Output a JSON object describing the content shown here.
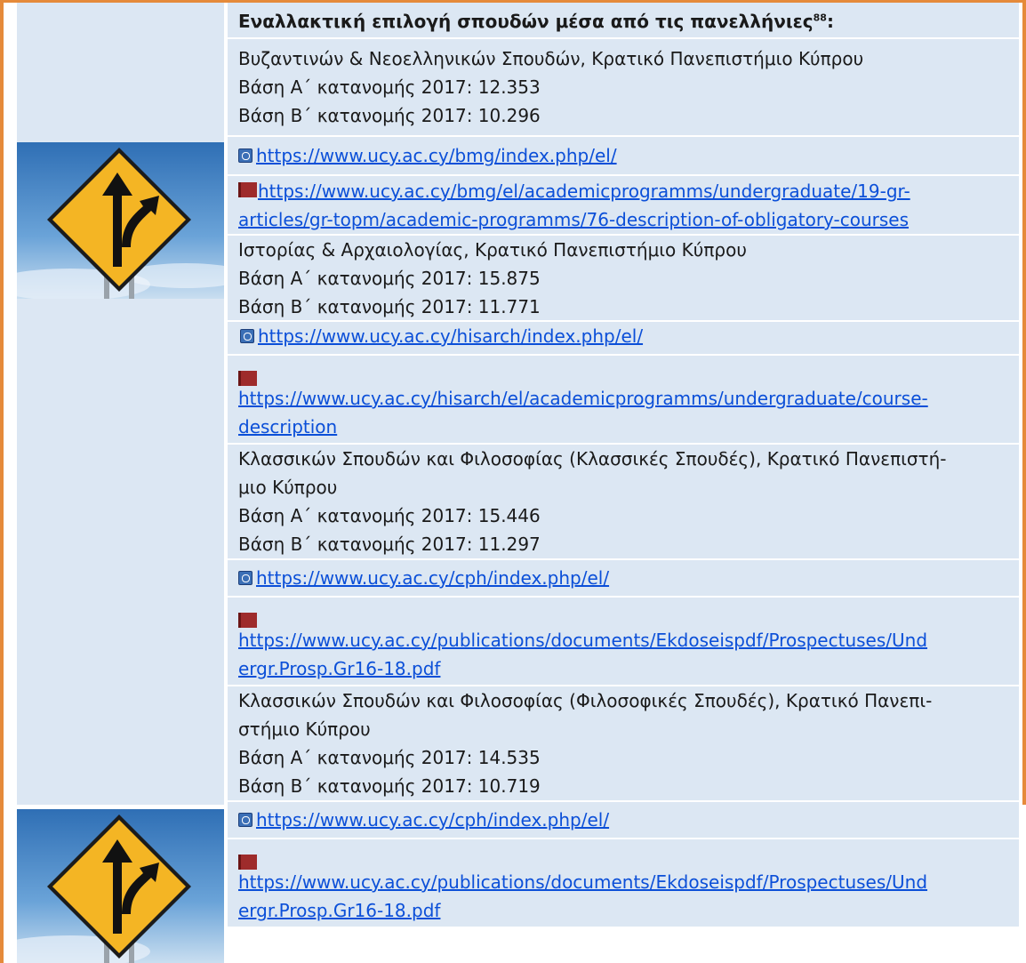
{
  "header": {
    "title": "Εναλλακτική επιλογή σπουδών μέσα από τις πανελλήνιες",
    "footnote": "88",
    "suffix": ":"
  },
  "programs": [
    {
      "name": "Βυζαντινών & Νεοελληνικών Σπουδών, Κρατικό Πανεπιστήμιο Κύπρου",
      "base_a": "Βάση Α΄ κατανομής 2017: 12.353",
      "base_b": "Βάση Β΄ κατανομής 2017: 10.296",
      "web_link": "https://www.ucy.ac.cy/bmg/index.php/el/",
      "book_link_1": "https://www.ucy.ac.cy/bmg/el/academicprogramms/undergraduate/19-gr-",
      "book_link_2": "articles/gr-topm/academic-programms/76-description-of-obligatory-courses"
    },
    {
      "name": "Ιστορίας & Αρχαιολογίας, Κρατικό Πανεπιστήμιο Κύπρου",
      "base_a": "Βάση Α΄ κατανομής 2017: 15.875",
      "base_b": "Βάση Β΄ κατανομής 2017: 11.771",
      "web_link": "https://www.ucy.ac.cy/hisarch/index.php/el/",
      "book_link_1": "https://www.ucy.ac.cy/hisarch/el/academicprogramms/undergraduate/course-",
      "book_link_2": "description"
    },
    {
      "name_1": "Κλασσικών Σπουδών και Φιλοσοφίας (Κλασσικές Σπουδές), Κρατικό Πανεπιστή-",
      "name_2": "μιο Κύπρου",
      "base_a": "Βάση Α΄ κατανομής 2017: 15.446",
      "base_b": "Βάση Β΄ κατανομής 2017: 11.297",
      "web_link": "https://www.ucy.ac.cy/cph/index.php/el/",
      "book_link_1": "https://www.ucy.ac.cy/publications/documents/Ekdoseispdf/Prospectuses/Und",
      "book_link_2": "ergr.Prosp.Gr16-18.pdf"
    },
    {
      "name_1": "Κλασσικών Σπουδών και Φιλοσοφίας (Φιλοσοφικές Σπουδές), Κρατικό Πανεπι-",
      "name_2": "στήμιο Κύπρου",
      "base_a": "Βάση Α΄ κατανομής 2017: 14.535",
      "base_b": "Βάση Β΄ κατανομής 2017: 10.719",
      "web_link": "https://www.ucy.ac.cy/cph/index.php/el/",
      "book_link_1": "https://www.ucy.ac.cy/publications/documents/Ekdoseispdf/Prospectuses/Und",
      "book_link_2": "ergr.Prosp.Gr16-18.pdf"
    }
  ],
  "icons": {
    "sign": "road-fork-sign-icon",
    "web": "web-link-icon",
    "book": "book-icon"
  },
  "colors": {
    "frame": "#e58a3a",
    "cell_bg": "#dce7f3",
    "link": "#0b4fd8",
    "sign_yellow": "#f4b524",
    "sky": "#4a86c5"
  }
}
